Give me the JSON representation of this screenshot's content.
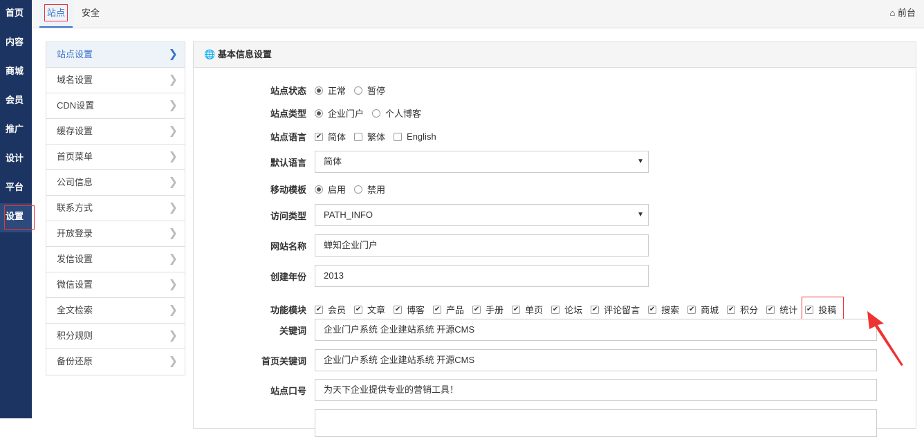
{
  "sidebar": {
    "items": [
      "首页",
      "内容",
      "商城",
      "会员",
      "推广",
      "设计",
      "平台",
      "设置"
    ]
  },
  "top": {
    "tabs": [
      "站点",
      "安全"
    ],
    "front": "前台"
  },
  "submenu": [
    "站点设置",
    "域名设置",
    "CDN设置",
    "缓存设置",
    "首页菜单",
    "公司信息",
    "联系方式",
    "开放登录",
    "发信设置",
    "微信设置",
    "全文检索",
    "积分规则",
    "备份还原"
  ],
  "panel": {
    "title": "基本信息设置"
  },
  "form": {
    "status": {
      "label": "站点状态",
      "options": [
        "正常",
        "暂停"
      ]
    },
    "type": {
      "label": "站点类型",
      "options": [
        "企业门户",
        "个人博客"
      ]
    },
    "lang": {
      "label": "站点语言",
      "options": [
        "简体",
        "繁体",
        "English"
      ]
    },
    "default_lang": {
      "label": "默认语言",
      "value": "简体"
    },
    "mobile": {
      "label": "移动模板",
      "options": [
        "启用",
        "禁用"
      ]
    },
    "access": {
      "label": "访问类型",
      "value": "PATH_INFO"
    },
    "name": {
      "label": "网站名称",
      "value": "蝉知企业门户"
    },
    "year": {
      "label": "创建年份",
      "value": "2013"
    },
    "modules": {
      "label": "功能模块",
      "options": [
        "会员",
        "文章",
        "博客",
        "产品",
        "手册",
        "单页",
        "论坛",
        "评论留言",
        "搜索",
        "商城",
        "积分",
        "统计",
        "投稿"
      ]
    },
    "keywords": {
      "label": "关键词",
      "value": "企业门户系统 企业建站系统 开源CMS"
    },
    "index_keywords": {
      "label": "首页关键词",
      "value": "企业门户系统 企业建站系统 开源CMS"
    },
    "slogan": {
      "label": "站点口号",
      "value": "为天下企业提供专业的营销工具！"
    }
  }
}
